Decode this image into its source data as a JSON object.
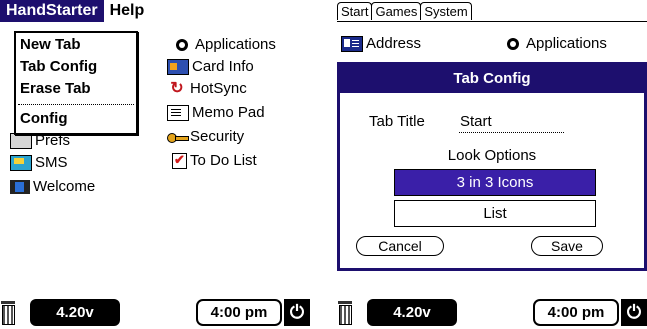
{
  "left": {
    "menubar": {
      "handstarter": "HandStarter",
      "help": "Help"
    },
    "dropdown": [
      "New Tab",
      "Tab Config",
      "Erase Tab",
      "Config"
    ],
    "list_right": [
      "Applications",
      "Card Info",
      "HotSync",
      "Memo Pad",
      "Security",
      "To Do List"
    ],
    "list_left": [
      "Prefs",
      "SMS",
      "Welcome"
    ],
    "status": {
      "battery": "4.20v",
      "time": "4:00 pm"
    }
  },
  "right": {
    "tabs": [
      "Start",
      "Games",
      "System"
    ],
    "list": [
      "Address",
      "Applications"
    ],
    "dialog": {
      "title": "Tab Config",
      "tab_title_label": "Tab Title",
      "tab_title_value": "Start",
      "look_options_label": "Look Options",
      "options": [
        "3 in 3 Icons",
        "List"
      ],
      "cancel": "Cancel",
      "save": "Save"
    },
    "status": {
      "battery": "4.20v",
      "time": "4:00 pm"
    }
  },
  "icons": {
    "applications": "applications-icon",
    "card_info": "card-info-icon",
    "hotsync": "hotsync-icon",
    "memo_pad": "memo-pad-icon",
    "security": "key-icon",
    "todo": "todo-check-icon",
    "prefs": "prefs-icon",
    "sms": "sms-icon",
    "welcome": "welcome-icon",
    "address": "address-icon",
    "trash": "trash-icon",
    "power": "power-icon"
  },
  "colors": {
    "menu_highlight": "#1d0f6e",
    "selected_option": "#3a1fa8"
  }
}
